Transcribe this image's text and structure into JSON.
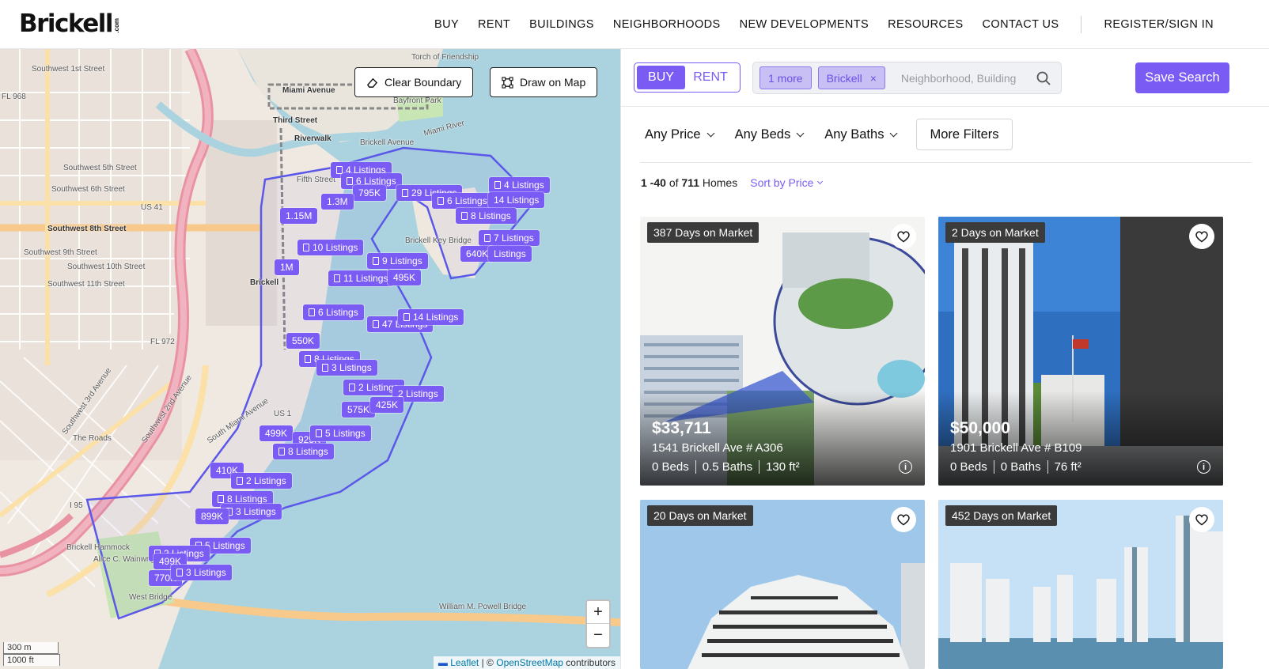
{
  "brand": {
    "name": "Brickell",
    "suffix": ".com"
  },
  "nav": {
    "items": [
      "BUY",
      "RENT",
      "BUILDINGS",
      "NEIGHBORHOODS",
      "NEW DEVELOPMENTS",
      "RESOURCES",
      "CONTACT US"
    ],
    "register": "REGISTER/SIGN IN"
  },
  "map": {
    "clear_boundary": "Clear Boundary",
    "draw_on_map": "Draw on Map",
    "zoom_in": "+",
    "zoom_out": "−",
    "scale_metric": "300 m",
    "scale_imperial": "1000 ft",
    "attribution": {
      "leaflet": "Leaflet",
      "sep": "| ©",
      "osm": "OpenStreetMap",
      "contrib": "contributors"
    },
    "labels": [
      "Southwest 1st Street",
      "Miami Avenue",
      "Third Street",
      "Riverwalk",
      "Brickell Avenue",
      "Southwest 8th Street",
      "US 41",
      "Fifth Street",
      "Brickell Key Bridge",
      "Brickell",
      "South Miami Avenue",
      "Southwest 3rd Avenue",
      "The Roads",
      "US 1",
      "I 95",
      "Brickell Hammock",
      "Alice C. Wainwright Park",
      "West Bridge",
      "William M. Powell Bridge",
      "Torch of Friendship",
      "Bayfront Park",
      "Miami River",
      "FL 968",
      "FL 972",
      "Southwest 2nd Avenue",
      "Southwest 5th Street",
      "Southwest 6th Street",
      "Southwest 9th Street",
      "Southwest 10th Street",
      "Southwest 11th Street"
    ],
    "markers": [
      {
        "label": "4 Listings",
        "icon": true
      },
      {
        "label": "6 Listings",
        "icon": true
      },
      {
        "label": "795K",
        "icon": false
      },
      {
        "label": "1.3M",
        "icon": false
      },
      {
        "label": "29 Listings",
        "icon": true
      },
      {
        "label": "6 Listings",
        "icon": true
      },
      {
        "label": "4 Listings",
        "icon": true
      },
      {
        "label": "14 Listings",
        "icon": false
      },
      {
        "label": "1.15M",
        "icon": false
      },
      {
        "label": "8 Listings",
        "icon": true
      },
      {
        "label": "7 Listings",
        "icon": true
      },
      {
        "label": "10 Listings",
        "icon": true
      },
      {
        "label": "640K",
        "icon": false
      },
      {
        "label": "Listings",
        "icon": false
      },
      {
        "label": "9 Listings",
        "icon": true
      },
      {
        "label": "1M",
        "icon": false
      },
      {
        "label": "11 Listings",
        "icon": true
      },
      {
        "label": "495K",
        "icon": false
      },
      {
        "label": "6 Listings",
        "icon": true
      },
      {
        "label": "47 Listings",
        "icon": true
      },
      {
        "label": "14 Listings",
        "icon": true
      },
      {
        "label": "550K",
        "icon": false
      },
      {
        "label": "8 Listings",
        "icon": true
      },
      {
        "label": "3 Listings",
        "icon": true
      },
      {
        "label": "2 Listings",
        "icon": true
      },
      {
        "label": "2 Listings",
        "icon": false
      },
      {
        "label": "575K",
        "icon": false
      },
      {
        "label": "425K",
        "icon": false
      },
      {
        "label": "499K",
        "icon": false
      },
      {
        "label": "925K",
        "icon": false
      },
      {
        "label": "5 Listings",
        "icon": true
      },
      {
        "label": "8 Listings",
        "icon": true
      },
      {
        "label": "410K",
        "icon": false
      },
      {
        "label": "2 Listings",
        "icon": true
      },
      {
        "label": "8 Listings",
        "icon": true
      },
      {
        "label": "3 Listings",
        "icon": true
      },
      {
        "label": "899K",
        "icon": false
      },
      {
        "label": "5 Listings",
        "icon": true
      },
      {
        "label": "2 Listings",
        "icon": true
      },
      {
        "label": "499K",
        "icon": false
      },
      {
        "label": "770K",
        "icon": false
      },
      {
        "label": "3 Listings",
        "icon": true
      }
    ]
  },
  "search": {
    "buy": "BUY",
    "rent": "RENT",
    "chip_more": "1 more",
    "chip_area": "Brickell",
    "chip_close": "×",
    "placeholder": "Neighborhood, Building",
    "save": "Save Search"
  },
  "filters": {
    "price": "Any Price",
    "beds": "Any Beds",
    "baths": "Any Baths",
    "more": "More Filters"
  },
  "results": {
    "range": "1 -40",
    "of": "of",
    "total": "711",
    "unit": "Homes",
    "sort": "Sort by Price"
  },
  "listings": [
    {
      "days": "387 Days on Market",
      "price": "$33,711",
      "address": "1541 Brickell Ave # A306",
      "beds": "0 Beds",
      "baths": "0.5 Baths",
      "sqft": "130 ft²"
    },
    {
      "days": "2 Days on Market",
      "price": "$50,000",
      "address": "1901 Brickell Ave # B109",
      "beds": "0 Beds",
      "baths": "0 Baths",
      "sqft": "76 ft²"
    },
    {
      "days": "20 Days on Market"
    },
    {
      "days": "452 Days on Market"
    }
  ],
  "colors": {
    "accent": "#7a5cf5",
    "chip_bg": "#c8c0f4",
    "water": "#aad3df"
  }
}
